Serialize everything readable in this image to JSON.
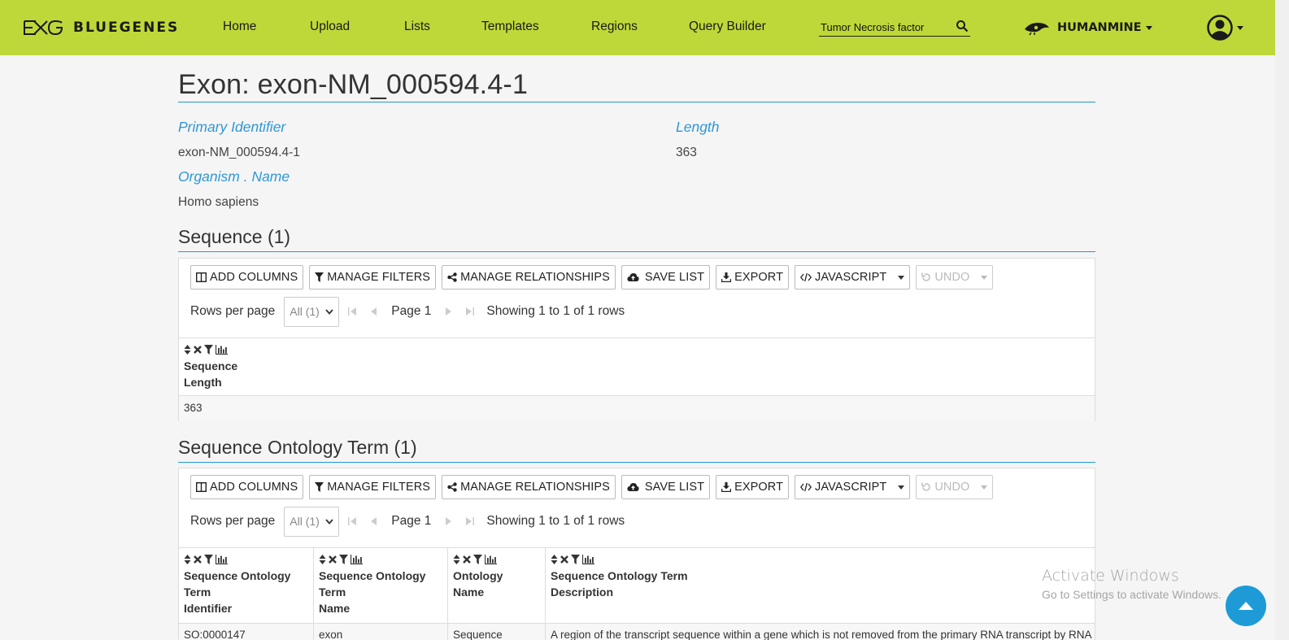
{
  "navbar": {
    "brand": "BLUEGENES",
    "items": [
      "Home",
      "Upload",
      "Lists",
      "Templates",
      "Regions",
      "Query Builder"
    ],
    "search_value": "Tumor Necrosis factor",
    "mine": "HUMANMINE",
    "accent": "#bfd839"
  },
  "report": {
    "title": "Exon: exon-NM_000594.4-1",
    "fields": [
      {
        "label": "Primary Identifier",
        "value": "exon-NM_000594.4-1"
      },
      {
        "label": "Length",
        "value": "363"
      },
      {
        "label": "Organism . Name",
        "value": "Homo sapiens"
      }
    ]
  },
  "toolbar": {
    "add_columns": "ADD COLUMNS",
    "manage_filters": "MANAGE FILTERS",
    "manage_relationships": "MANAGE RELATIONSHIPS",
    "save_list": "SAVE LIST",
    "export": "EXPORT",
    "javascript": "JAVASCRIPT",
    "undo": "UNDO"
  },
  "pager": {
    "rows_per_page_label": "Rows per page",
    "rows_per_page_value": "All (1)",
    "page": "Page 1",
    "showing": "Showing 1 to 1 of 1 rows"
  },
  "sections": [
    {
      "title": "Sequence (1)",
      "headers": [
        [
          "Sequence",
          "Length"
        ]
      ],
      "rows": [
        [
          "363"
        ]
      ]
    },
    {
      "title": "Sequence Ontology Term (1)",
      "headers": [
        [
          "Sequence Ontology",
          "Term",
          "Identifier"
        ],
        [
          "Sequence Ontology",
          "Term",
          "Name"
        ],
        [
          "Ontology",
          "Name"
        ],
        [
          "Sequence Ontology Term",
          "Description"
        ]
      ],
      "rows": [
        [
          "SO:0000147",
          "exon",
          "Sequence",
          "A region of the transcript sequence within a gene which is not removed from the primary RNA transcript by RNA"
        ]
      ]
    }
  ],
  "watermark": {
    "title": "Activate Windows",
    "subtitle": "Go to Settings to activate Windows."
  }
}
